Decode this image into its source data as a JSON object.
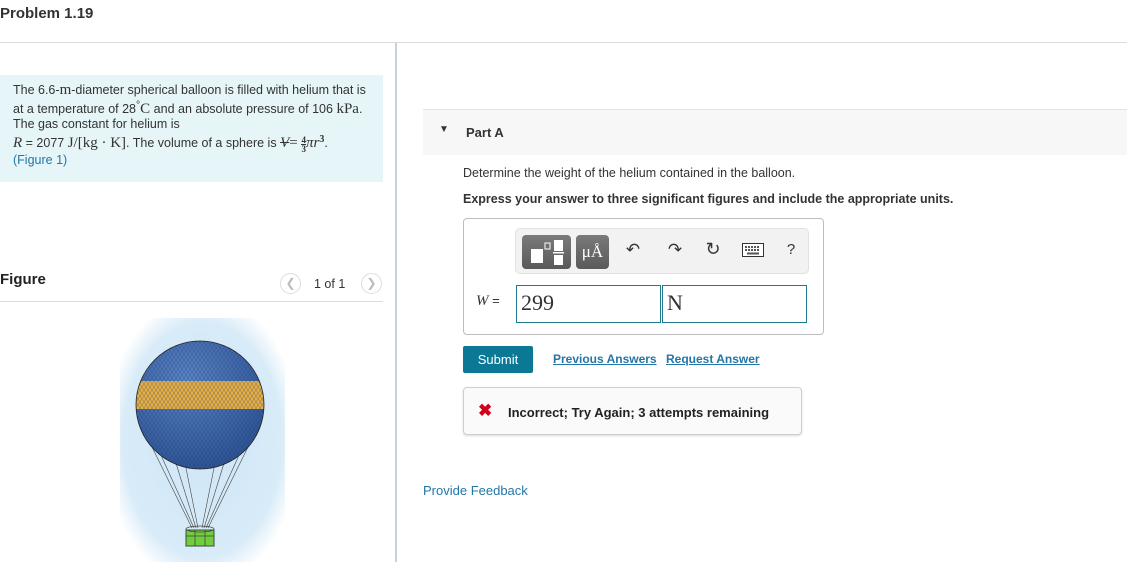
{
  "problem": {
    "title": "Problem 1.19"
  },
  "statement": {
    "p1": "The 6.6-",
    "unit_m": "m",
    "p2": "-diameter spherical balloon is filled with helium that is at a temperature of 28",
    "deg": "°",
    "unit_c": "C",
    "p3": " and an absolute pressure of 106 ",
    "unit_kpa": "kPa",
    "p4": ". The gas constant for helium is",
    "r_sym": "R",
    "r_val": " = 2077 ",
    "r_unit": "J/[kg · K]",
    "p5": ". The volume of a sphere is ",
    "v_sym": "V",
    "eq": "= ",
    "frac_num": "4",
    "frac_den": "3",
    "pi_r": "πr",
    "exp": "3",
    "end": ".",
    "figure_link": "(Figure 1)"
  },
  "figure": {
    "label": "Figure",
    "pager": "1 of 1",
    "prev_icon": "chevron-left-icon",
    "next_icon": "chevron-right-icon",
    "image_desc": "Spherical helium balloon with blue and yellow netting and green basket"
  },
  "part": {
    "caret_icon": "caret-down-icon",
    "title": "Part A",
    "question": "Determine the weight of the helium contained in the balloon.",
    "instruction": "Express your answer to three significant figures and include the appropriate units."
  },
  "toolbar": {
    "units_label": "μÅ",
    "undo_icon": "↶",
    "redo_icon": "↷",
    "reset_icon": "↻",
    "help_label": "?"
  },
  "answer": {
    "variable": "W",
    "equals": " =",
    "value": "299",
    "unit": "N"
  },
  "actions": {
    "submit": "Submit",
    "previous_answers": "Previous Answers",
    "request_answer": "Request Answer"
  },
  "feedback": {
    "icon": "✖",
    "message": "Incorrect; Try Again; 3 attempts remaining"
  },
  "footer": {
    "provide_feedback": "Provide Feedback"
  },
  "colors": {
    "accent": "#0b7996",
    "link": "#2476a8",
    "error": "#d0021b",
    "statement_bg": "#e6f5f7"
  }
}
